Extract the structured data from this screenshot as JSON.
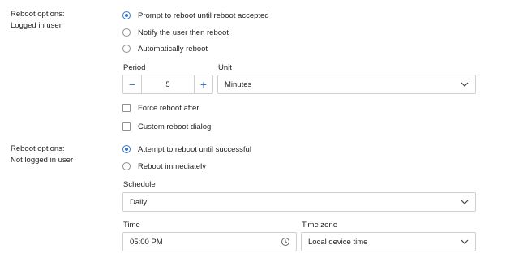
{
  "logged_in": {
    "label_line1": "Reboot options:",
    "label_line2": "Logged in user",
    "options": [
      {
        "label": "Prompt to reboot until reboot accepted",
        "selected": true
      },
      {
        "label": "Notify the user then reboot",
        "selected": false
      },
      {
        "label": "Automatically reboot",
        "selected": false
      }
    ],
    "period": {
      "label": "Period",
      "value": "5",
      "decrement": "−",
      "increment": "+"
    },
    "unit": {
      "label": "Unit",
      "value": "Minutes"
    },
    "checkboxes": [
      {
        "label": "Force reboot after",
        "checked": false
      },
      {
        "label": "Custom reboot dialog",
        "checked": false
      }
    ]
  },
  "not_logged_in": {
    "label_line1": "Reboot options:",
    "label_line2": "Not logged in user",
    "options": [
      {
        "label": "Attempt to reboot until successful",
        "selected": true
      },
      {
        "label": "Reboot immediately",
        "selected": false
      }
    ],
    "schedule": {
      "label": "Schedule",
      "value": "Daily"
    },
    "time": {
      "label": "Time",
      "value": "05:00 PM"
    },
    "timezone": {
      "label": "Time zone",
      "value": "Local device time"
    }
  },
  "colors": {
    "accent": "#3b73c9",
    "border": "#cfcfcf"
  },
  "icons": {
    "dropdown": "chevron-down-icon",
    "time": "clock-icon"
  }
}
